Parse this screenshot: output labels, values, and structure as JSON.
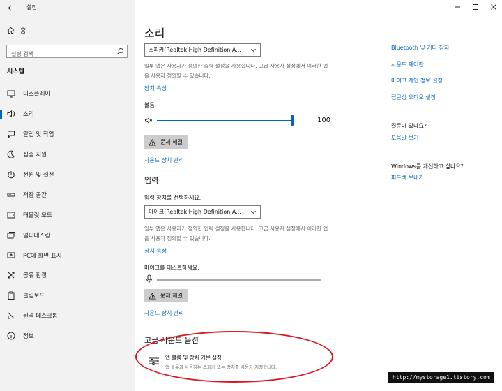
{
  "window": {
    "title": "설정",
    "back_icon": "back-arrow-icon",
    "controls": [
      "minimize",
      "maximize",
      "close"
    ]
  },
  "sidebar": {
    "home_label": "홈",
    "search_placeholder": "설정 검색",
    "section_title": "시스템",
    "active_index": 1,
    "items": [
      {
        "label": "디스플레이",
        "icon": "display-icon"
      },
      {
        "label": "소리",
        "icon": "speaker-icon"
      },
      {
        "label": "알림 및 작업",
        "icon": "notification-icon"
      },
      {
        "label": "집중 지원",
        "icon": "moon-icon"
      },
      {
        "label": "전원 및 절전",
        "icon": "power-icon"
      },
      {
        "label": "저장 공간",
        "icon": "storage-icon"
      },
      {
        "label": "태블릿 모드",
        "icon": "tablet-icon"
      },
      {
        "label": "멀티태스킹",
        "icon": "multitask-icon"
      },
      {
        "label": "PC에 화면 표시",
        "icon": "project-icon"
      },
      {
        "label": "공유 환경",
        "icon": "share-icon"
      },
      {
        "label": "클립보드",
        "icon": "clipboard-icon"
      },
      {
        "label": "원격 데스크톱",
        "icon": "remote-desktop-icon"
      },
      {
        "label": "정보",
        "icon": "info-icon"
      }
    ]
  },
  "main": {
    "title": "소리",
    "output": {
      "device": "스피커(Realtek High Definition A...",
      "description": "일부 앱은 사용자가 정의한 출력 설정을 사용합니다. 고급 사용자 설정에서 이러한 앱을 사용자 정의할 수 있습니다.",
      "device_props_link": "장치 속성",
      "volume_label": "볼륨",
      "volume_value": "100",
      "volume_fraction": 1.0,
      "troubleshoot_label": "문제 해결",
      "manage_link": "사운드 장치 관리"
    },
    "input": {
      "heading": "입력",
      "select_label": "입력 장치를 선택하세요.",
      "device": "마이크(Realtek High Definition A...",
      "description": "일부 앱은 사용자가 정의한 입력 설정을 사용합니다. 고급 사용자 설정에서 이러한 앱을 사용자 정의할 수 있습니다.",
      "device_props_link": "장치 속성",
      "test_label": "마이크를 테스트하세요.",
      "troubleshoot_label": "문제 해결",
      "manage_link": "사운드 장치 관리"
    },
    "advanced": {
      "heading": "고급 사운드 옵션",
      "item_title": "앱 볼륨 및 장치 기본 설정",
      "item_desc": "앱 볼륨과 사용하는 스피커 또는 장치를 사용자 지정합니다."
    }
  },
  "related": {
    "links": [
      "Bluetooth 및 기타 장치",
      "사운드 제어판",
      "마이크 개인 정보 설정",
      "접근성 오디오 설정"
    ],
    "question_heading": "질문이 있나요?",
    "help_link": "도움말 보기",
    "improve_heading": "Windows를 개선하고 싶나요?",
    "feedback_link": "피드백 보내기"
  },
  "watermark": "http://mystorage1.tistory.com",
  "colors": {
    "accent": "#0067c0",
    "sidebar_bg": "#f2f2f2",
    "button_bg": "#cccccc",
    "annotation": "#e0151d"
  }
}
